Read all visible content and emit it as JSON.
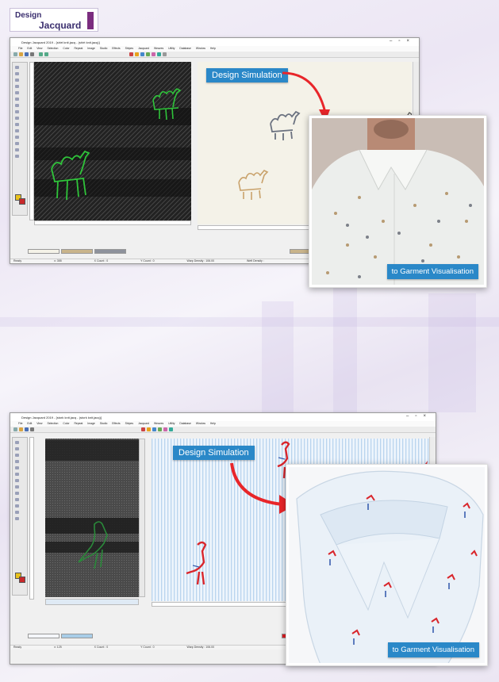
{
  "logo": {
    "line1": "Design",
    "line2": "Jacquard"
  },
  "top_window": {
    "title": "Design Jacquard 2019 - [shirt knit.jacq - (shirt knit.jacq)]",
    "menu": [
      "File",
      "Edit",
      "View",
      "Selection",
      "Color",
      "Repeat",
      "Image",
      "Studio",
      "Effects",
      "Stripes",
      "Jacquard",
      "Weaves",
      "Utility",
      "Database",
      "Window",
      "Help"
    ],
    "status": [
      "Ready",
      "x: 355",
      "X Count : 0",
      "Y Count : 0",
      "Warp Density : 106.00",
      "Weft Density :"
    ],
    "colors": [
      "",
      "",
      ""
    ],
    "callout": "Design Simulation",
    "garment_label": "to Garment Visualisation"
  },
  "bottom_window": {
    "title": "Design Jacquard 2019 - [stork knit.jacq - (stork knit.jacq)]",
    "menu": [
      "File",
      "Edit",
      "View",
      "Selection",
      "Color",
      "Repeat",
      "Image",
      "Studio",
      "Effects",
      "Stripes",
      "Jacquard",
      "Weaves",
      "Utility",
      "Database",
      "Window",
      "Help"
    ],
    "status": [
      "Ready",
      "x: 125",
      "X Count : 0",
      "Y Count : 0",
      "Warp Density : 106.00"
    ],
    "callout": "Design Simulation",
    "garment_label": "to Garment Visualisation"
  },
  "colors": {
    "accent_blue": "#2a88c8",
    "motif_green": "#2fc43a",
    "arrow_red": "#e8262a"
  }
}
